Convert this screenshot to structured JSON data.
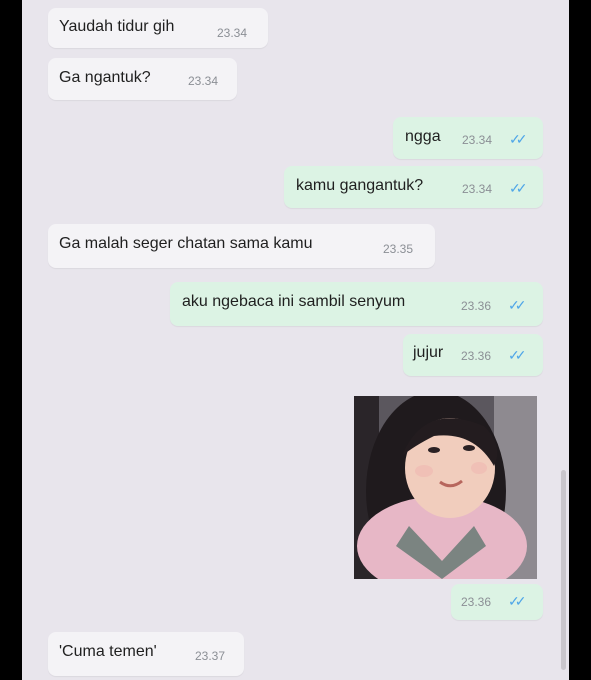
{
  "chat": {
    "messages": [
      {
        "direction": "in",
        "text": "Yaudah tidur gih",
        "time": "23.34"
      },
      {
        "direction": "in",
        "text": "Ga ngantuk?",
        "time": "23.34"
      },
      {
        "direction": "out",
        "text": "ngga",
        "time": "23.34",
        "ticks": "✓✓"
      },
      {
        "direction": "out",
        "text": "kamu gangantuk?",
        "time": "23.34",
        "ticks": "✓✓"
      },
      {
        "direction": "in",
        "text": "Ga malah seger chatan sama kamu",
        "time": "23.35"
      },
      {
        "direction": "out",
        "text": "aku ngebaca ini sambil senyum",
        "time": "23.36",
        "ticks": "✓✓"
      },
      {
        "direction": "out",
        "text": "jujur",
        "time": "23.36",
        "ticks": "✓✓"
      },
      {
        "direction": "out",
        "type": "image",
        "image_icon": "photo-girl",
        "time": "23.36",
        "ticks": "✓✓"
      },
      {
        "direction": "in",
        "text": "'Cuma temen'",
        "time": "23.37"
      }
    ]
  },
  "colors": {
    "background": "#e8e5ec",
    "incoming_bubble": "#f4f3f6",
    "outgoing_bubble": "#dcf3e4",
    "read_ticks": "#4fa6e8"
  }
}
